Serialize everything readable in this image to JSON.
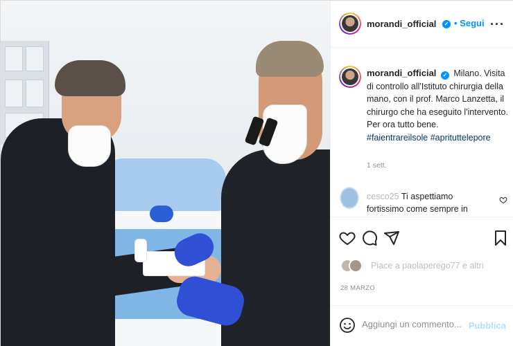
{
  "header": {
    "username": "morandi_official",
    "follow_label": "Segui",
    "more_icon": "more-options-icon"
  },
  "caption": {
    "username": "morandi_official",
    "lines": [
      "Milano. Visita di controllo all'Istituto chirurgia della mano, con il prof. Marco Lanzetta, il chirurgo che ha eseguito l'intervento.",
      "Per ora tutto bene."
    ],
    "hashtags": "#faientrareilsole #aprituttelepore",
    "time": "1 sett."
  },
  "comment": {
    "username": "cesco25",
    "text": "Ti aspettiamo fortissimo come sempre in piazza Maggiore il"
  },
  "actions": {
    "likes_text": "Piace a paolaperego77 e altri",
    "date": "28 MARZO"
  },
  "add_comment": {
    "placeholder": "Aggiungi un commento...",
    "publish_label": "Pubblica"
  },
  "colors": {
    "link_blue": "#0095f6",
    "hashtag_blue": "#00376b",
    "publish_disabled": "#b2dffc",
    "text_gray": "#8e8e8e"
  }
}
